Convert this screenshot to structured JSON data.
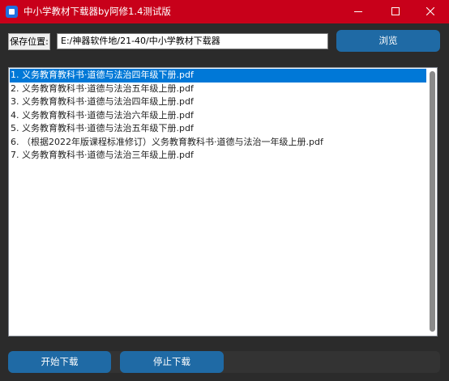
{
  "window": {
    "title": "中小学教材下载器by阿修1.4测试版"
  },
  "save": {
    "label": "保存位置:",
    "path": "E:/神器软件地/21-40/中小学教材下载器"
  },
  "buttons": {
    "browse": "浏览",
    "start": "开始下载",
    "stop": "停止下载"
  },
  "files": {
    "selected_index": 0,
    "items": [
      "1. 义务教育教科书·道德与法治四年级下册.pdf",
      "2. 义务教育教科书·道德与法治五年级上册.pdf",
      "3. 义务教育教科书·道德与法治四年级上册.pdf",
      "4. 义务教育教科书·道德与法治六年级上册.pdf",
      "5. 义务教育教科书·道德与法治五年级下册.pdf",
      "6. （根据2022年版课程标准修订）义务教育教科书·道德与法治一年级上册.pdf",
      "7. 义务教育教科书·道德与法治三年级上册.pdf"
    ]
  },
  "colors": {
    "titlebar": "#c8001a",
    "accent": "#1f6aa5",
    "selection": "#0078d7",
    "background": "#2b2b2b"
  },
  "icons": {
    "app": "app-icon",
    "minimize": "minimize-icon",
    "maximize": "maximize-icon",
    "close": "close-icon"
  }
}
